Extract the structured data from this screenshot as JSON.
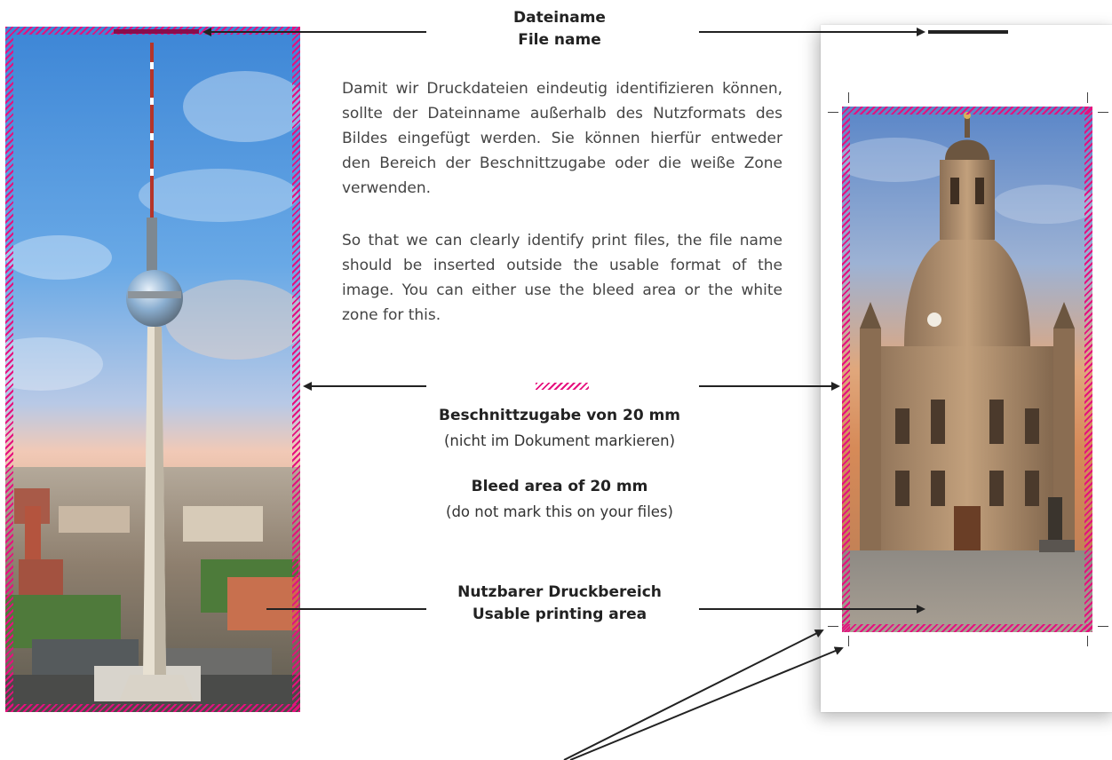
{
  "file_name_label": {
    "de": "Dateiname",
    "en": "File name"
  },
  "description": {
    "de": "Damit wir Druckdateien eindeutig identifizieren können, sollte der Dateinname außerhalb des Nutzformats des Bildes eingefügt werden. Sie kön­nen hierfür entweder den Bereich der Beschnittzu­gabe oder die weiße Zone verwenden.",
    "en": "So that we can clearly identify print files, the file name should be inserted outside the usable for­mat of the image. You can either use the bleed area or the white zone for this."
  },
  "bleed_label": {
    "de_title": "Beschnittzugabe von 20 mm",
    "de_note": "(nicht im Dokument markieren)",
    "en_title": "Bleed area of 20 mm",
    "en_note": "(do not mark this on your files)"
  },
  "usable_area_label": {
    "de": "Nutzbarer Druckbereich",
    "en": "Usable printing area"
  },
  "colors": {
    "bleed_hatch": "#e6107e",
    "arrow": "#222222",
    "crop_marks": "#444444"
  },
  "images": {
    "left": "berlin-tv-tower-photo",
    "right": "dresden-frauenkirche-photo"
  }
}
